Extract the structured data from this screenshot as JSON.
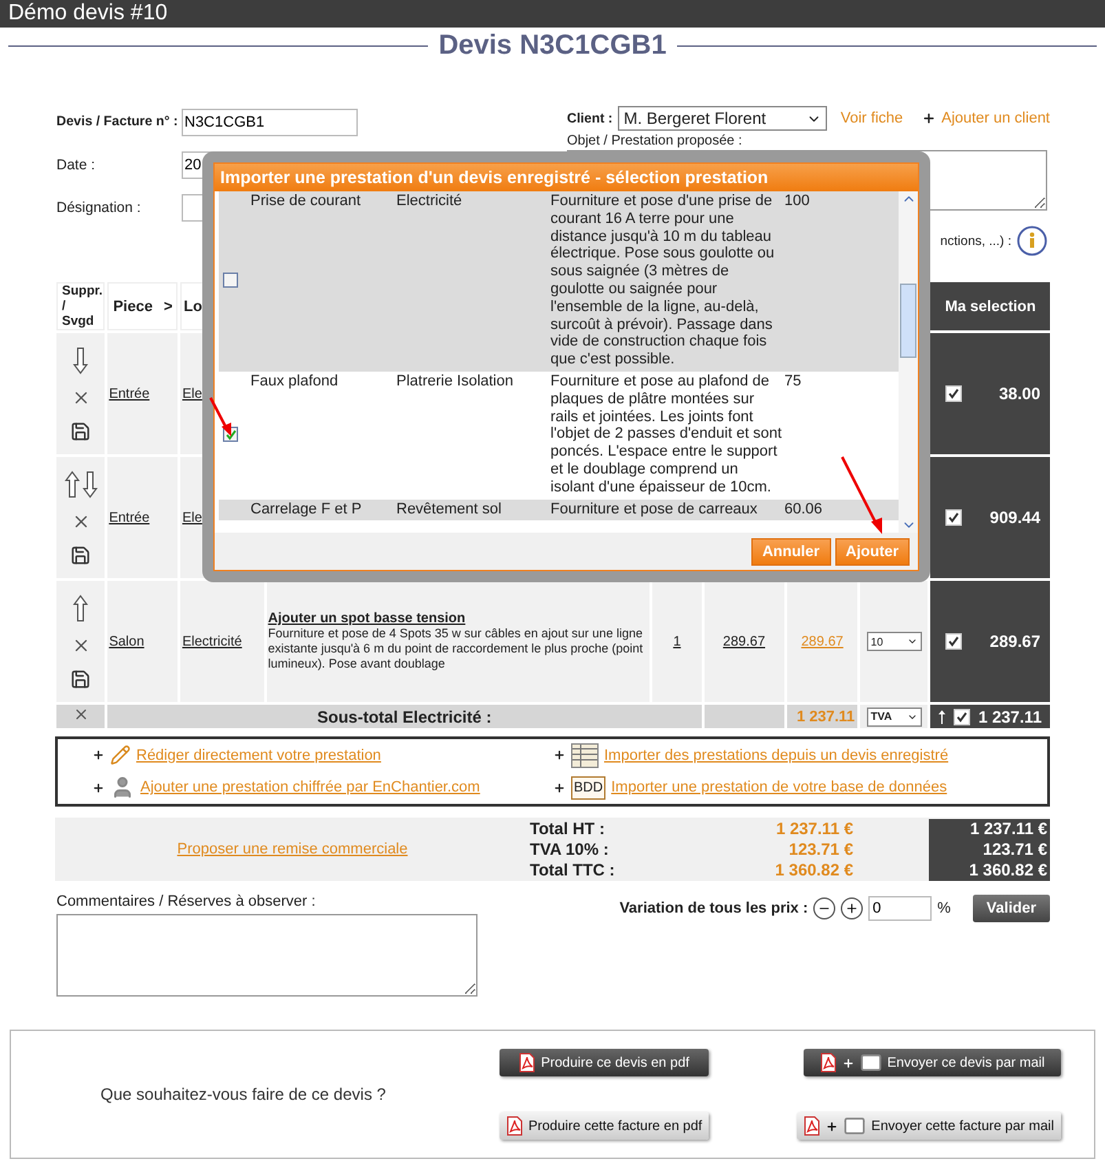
{
  "window": {
    "title": "Démo devis #10"
  },
  "heading": "Devis N3C1CGB1",
  "form": {
    "number": {
      "label": "Devis / Facture n° :",
      "value": "N3C1CGB1"
    },
    "date": {
      "label": "Date :",
      "value": "20"
    },
    "designation": {
      "label": "Désignation :"
    },
    "client": {
      "label": "Client :",
      "value": "M. Bergeret Florent",
      "view_link": "Voir fiche",
      "add_link": "Ajouter un client"
    },
    "object": {
      "label": "Objet / Prestation proposée :"
    },
    "hint": "nctions, ...) :"
  },
  "table": {
    "columns": [
      {
        "label": "Suppr. / Svgd"
      },
      {
        "label": "Piece",
        "marker": ">"
      },
      {
        "label": "Lo"
      },
      {
        "label": "Ma selection"
      }
    ],
    "rows": [
      {
        "moves": [
          {
            "kind": "down"
          }
        ],
        "room": "Entrée",
        "lot": "Ele",
        "selected": true,
        "amount": "38.00"
      },
      {
        "moves": [
          {
            "kind": "up"
          },
          {
            "kind": "down"
          }
        ],
        "room": "Entrée",
        "lot": "Ele",
        "selected": true,
        "amount": "909.44"
      },
      {
        "moves": [
          {
            "kind": "up"
          }
        ],
        "room": "Salon",
        "lot": "Electricité",
        "title": "Ajouter un spot basse tension",
        "description": "Fourniture et pose de 4 Spots 35 w sur câbles en ajout sur une ligne existante jusqu'à 6 m du point de raccordement le plus proche (point lumineux). Pose avant doublage",
        "qty": "1",
        "unit_price": "289.67",
        "total": "289.67",
        "tva": "10",
        "selected": true,
        "amount": "289.67"
      }
    ],
    "subtotal": {
      "label": "Sous-total Electricité :",
      "total": "1 237.11",
      "tva": "TVA",
      "selected": true,
      "amount": "1 237.11"
    }
  },
  "actions": [
    {
      "kind": "pencil",
      "label": "Rédiger directement votre prestation"
    },
    {
      "kind": "table",
      "label": "Importer des prestations depuis un devis enregistré"
    },
    {
      "kind": "person",
      "label": "Ajouter une prestation chiffrée par EnChantier.com"
    },
    {
      "kind": "badge",
      "badge": "BDD",
      "label": "Importer une prestation de votre base de données"
    }
  ],
  "totals": {
    "discount_link": "Proposer une remise commerciale",
    "lines": [
      {
        "label": "Total HT :",
        "value": "1 237.11 €",
        "selection": "1 237.11 €"
      },
      {
        "label": "TVA 10% :",
        "value": "123.71 €",
        "selection": "123.71 €"
      },
      {
        "label": "Total TTC :",
        "value": "1 360.82 €",
        "selection": "1 360.82 €"
      }
    ]
  },
  "comments": {
    "label": "Commentaires / Réserves à observer :"
  },
  "variation": {
    "label": "Variation de tous les prix :",
    "value": "0",
    "unit": "%",
    "button": "Valider"
  },
  "footer": {
    "question": "Que souhaitez-vous faire de ce devis ?",
    "buttons": [
      {
        "label": "Produire ce devis en pdf",
        "kind": "dark",
        "mail": false
      },
      {
        "label": "Envoyer ce devis par mail",
        "kind": "dark",
        "mail": true
      },
      {
        "label": "Produire cette facture en pdf",
        "kind": "light",
        "mail": false
      },
      {
        "label": "Envoyer cette facture par mail",
        "kind": "light",
        "mail": true
      }
    ]
  },
  "modal": {
    "title": "Importer une prestation d'un devis enregistré - sélection prestation",
    "rows": [
      {
        "checked": false,
        "name": "Prise de courant",
        "category": "Electricité",
        "description": "Fourniture et pose d'une prise de courant 16 A terre pour une distance jusqu'à 10 m du tableau électrique. Pose sous goulotte ou sous saignée (3 mètres de goulotte ou saignée pour l'ensemble de la ligne, au-delà, surcoût à prévoir). Passage dans vide de construction chaque fois que c'est possible.",
        "price": "100"
      },
      {
        "checked": true,
        "name": "Faux plafond",
        "category": "Platrerie Isolation",
        "description": "Fourniture et pose au plafond de plaques de plâtre montées sur rails et jointées. Les joints font l'objet de 2 passes d'enduit et sont poncés. L'espace entre le support et le doublage comprend un isolant d'une épaisseur de 10cm.",
        "price": "75"
      },
      {
        "name": "Carrelage F et P",
        "category": "Revêtement sol",
        "description": "Fourniture et pose de carreaux",
        "price": "60.06"
      }
    ],
    "buttons": [
      "Annuler",
      "Ajouter"
    ]
  }
}
